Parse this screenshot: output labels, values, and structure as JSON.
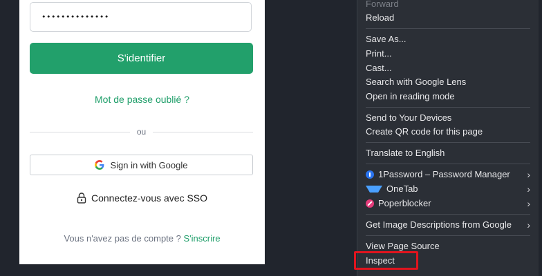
{
  "login": {
    "password_value": "••••••••••••••",
    "submit_label": "S'identifier",
    "forgot_label": "Mot de passe oublié ?",
    "or_label": "ou",
    "google_label": "Sign in with Google",
    "sso_label": "Connectez-vous avec SSO",
    "no_account_text": "Vous n'avez pas de compte ?",
    "signup_label": "S'inscrire",
    "accent_color": "#22a06b"
  },
  "context_menu": {
    "forward": "Forward",
    "reload": "Reload",
    "save_as": "Save As...",
    "print": "Print...",
    "cast": "Cast...",
    "search_lens": "Search with Google Lens",
    "reading_mode": "Open in reading mode",
    "send_devices": "Send to Your Devices",
    "qr_code": "Create QR code for this page",
    "translate": "Translate to English",
    "ext_1password": "1Password – Password Manager",
    "ext_onetab": "OneTab",
    "ext_poperblocker": "Poperblocker",
    "image_descriptions": "Get Image Descriptions from Google",
    "view_source": "View Page Source",
    "inspect": "Inspect",
    "highlight_color": "#e0141e"
  }
}
